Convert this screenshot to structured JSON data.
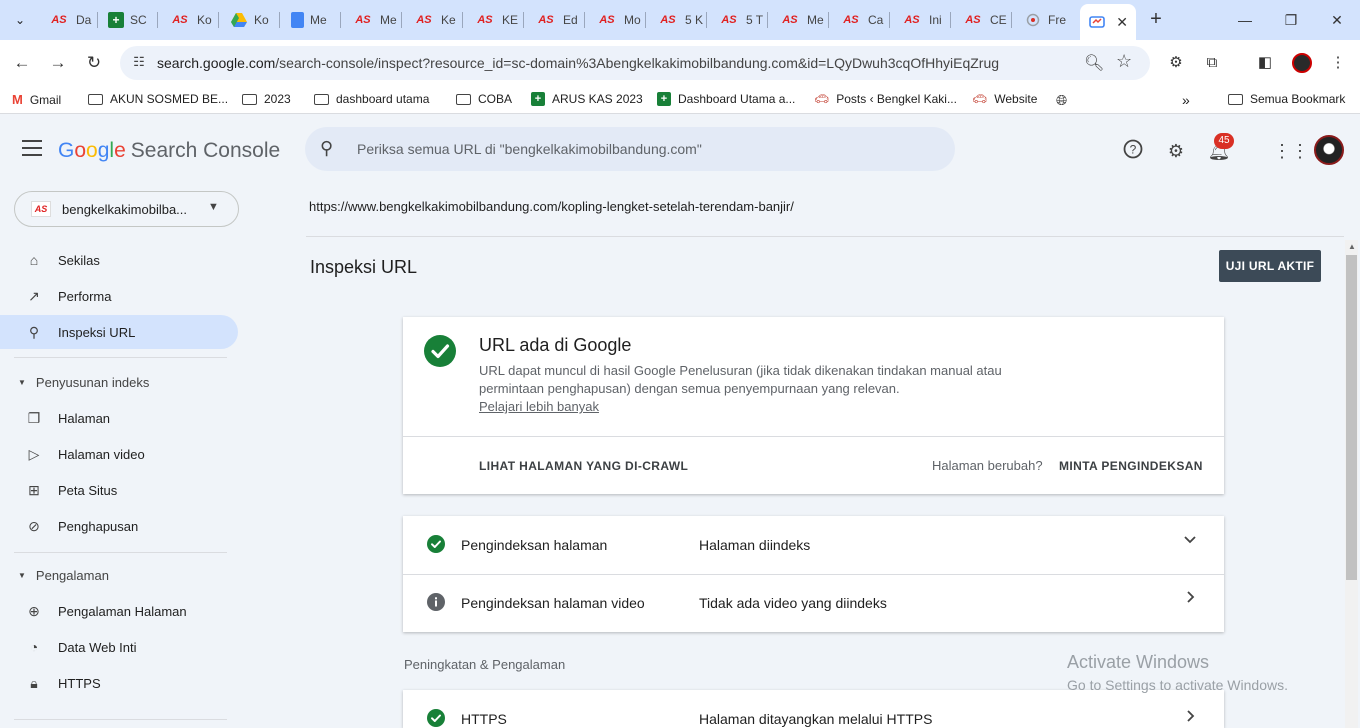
{
  "browser": {
    "tabs": [
      {
        "icon": "AS",
        "label": "Da"
      },
      {
        "icon": "sheet",
        "label": "SC"
      },
      {
        "icon": "AS",
        "label": "Ko"
      },
      {
        "icon": "drive",
        "label": "Ko"
      },
      {
        "icon": "doc",
        "label": "Me"
      },
      {
        "icon": "AS",
        "label": "Me"
      },
      {
        "icon": "AS",
        "label": "Ke"
      },
      {
        "icon": "AS",
        "label": "KE"
      },
      {
        "icon": "AS",
        "label": "Ed"
      },
      {
        "icon": "AS",
        "label": "Mo"
      },
      {
        "icon": "AS",
        "label": "5 K"
      },
      {
        "icon": "AS",
        "label": "5 T"
      },
      {
        "icon": "AS",
        "label": "Me"
      },
      {
        "icon": "AS",
        "label": "Ca"
      },
      {
        "icon": "AS",
        "label": "Ini"
      },
      {
        "icon": "AS",
        "label": "CE"
      },
      {
        "icon": "loader",
        "label": "Fre"
      }
    ],
    "url_host": "search.google.com",
    "url_path": "/search-console/inspect?resource_id=sc-domain%3Abengkelkakimobilbandung.com&id=LQyDwuh3cqOfHhyiEqZrug",
    "bookmarks": [
      {
        "icon": "gmail",
        "label": "Gmail"
      },
      {
        "icon": "folder",
        "label": "AKUN SOSMED BE..."
      },
      {
        "icon": "folder",
        "label": "2023"
      },
      {
        "icon": "folder",
        "label": "dashboard utama"
      },
      {
        "icon": "folder",
        "label": "COBA"
      },
      {
        "icon": "sheet",
        "label": "ARUS KAS 2023"
      },
      {
        "icon": "sheet",
        "label": "Dashboard Utama a..."
      },
      {
        "icon": "wp",
        "label": "Posts ‹ Bengkel Kaki..."
      },
      {
        "icon": "wp",
        "label": "Website"
      }
    ],
    "all_bookmarks": "Semua Bookmark"
  },
  "header": {
    "logo_letters": [
      "G",
      "o",
      "o",
      "g",
      "l",
      "e"
    ],
    "product": "Search Console",
    "search_placeholder": "Periksa semua URL di \"bengkelkakimobilbandung.com\"",
    "notification_count": "45"
  },
  "sidebar": {
    "property_name": "bengkelkakimobilba...",
    "property_icon": "AS",
    "items": [
      {
        "label": "Sekilas"
      },
      {
        "label": "Performa"
      },
      {
        "label": "Inspeksi URL"
      }
    ],
    "section_index": "Penyusunan indeks",
    "index_items": [
      {
        "label": "Halaman"
      },
      {
        "label": "Halaman video"
      },
      {
        "label": "Peta Situs"
      },
      {
        "label": "Penghapusan"
      }
    ],
    "section_experience": "Pengalaman",
    "experience_items": [
      {
        "label": "Pengalaman Halaman"
      },
      {
        "label": "Data Web Inti"
      },
      {
        "label": "HTTPS"
      }
    ]
  },
  "main": {
    "inspected_url": "https://www.bengkelkakimobilbandung.com/kopling-lengket-setelah-terendam-banjir/",
    "title": "Inspeksi URL",
    "test_live_button": "UJI URL AKTIF",
    "status": {
      "title": "URL ada di Google",
      "description": "URL dapat muncul di hasil Google Penelusuran (jika tidak dikenakan tindakan manual atau permintaan penghapusan) dengan semua penyempurnaan yang relevan.",
      "learn_more": "Pelajari lebih banyak",
      "view_crawled": "LIHAT HALAMAN YANG DI-CRAWL",
      "page_changed": "Halaman berubah?",
      "request_indexing": "MINTA PENGINDEKSAN"
    },
    "rows": [
      {
        "label": "Pengindeksan halaman",
        "value": "Halaman diindeks"
      },
      {
        "label": "Pengindeksan halaman video",
        "value": "Tidak ada video yang diindeks"
      }
    ],
    "section_enhancements": "Peningkatan & Pengalaman",
    "https_row": {
      "label": "HTTPS",
      "value": "Halaman ditayangkan melalui HTTPS"
    }
  },
  "watermark": {
    "line1": "Activate Windows",
    "line2": "Go to Settings to activate Windows."
  },
  "colors": {
    "success": "#188038",
    "accent_blue": "#d3e3fd",
    "button_dark": "#3c4a57"
  }
}
